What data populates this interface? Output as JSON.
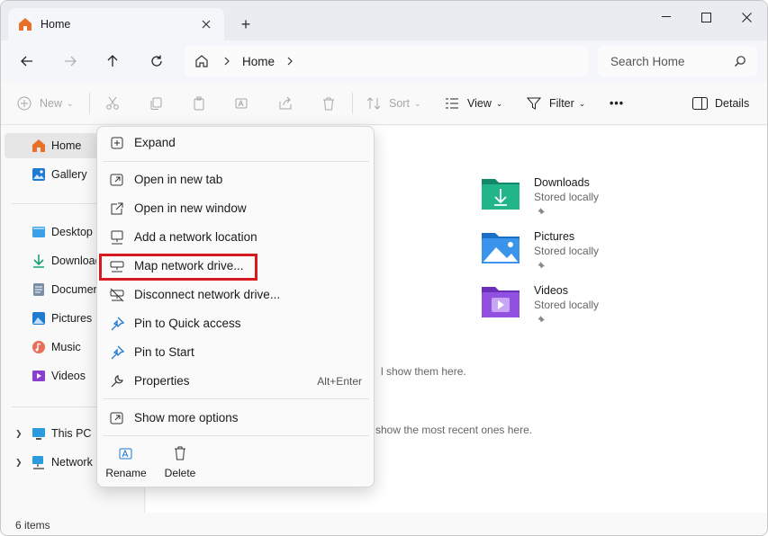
{
  "colors": {
    "accent": "#0067c0",
    "highlight": "#d71920",
    "folder_home": "#e8702a"
  },
  "tab": {
    "title": "Home",
    "close_icon": "close-icon",
    "new_tab_label": "+"
  },
  "nav": {
    "breadcrumb": "Home",
    "search_placeholder": "Search Home"
  },
  "toolbar": {
    "new_label": "New",
    "sort_label": "Sort",
    "view_label": "View",
    "filter_label": "Filter",
    "more_label": "•••",
    "details_label": "Details"
  },
  "sidebar": {
    "items": [
      {
        "label": "Home",
        "icon": "home-icon"
      },
      {
        "label": "Gallery",
        "icon": "gallery-icon"
      },
      {
        "label": "Desktop",
        "icon": "desktop-icon"
      },
      {
        "label": "Downloads",
        "icon": "download-icon"
      },
      {
        "label": "Documents",
        "icon": "documents-icon"
      },
      {
        "label": "Pictures",
        "icon": "pictures-icon"
      },
      {
        "label": "Music",
        "icon": "music-icon"
      },
      {
        "label": "Videos",
        "icon": "videos-icon"
      },
      {
        "label": "This PC",
        "icon": "pc-icon"
      },
      {
        "label": "Network",
        "icon": "network-icon"
      }
    ]
  },
  "quick_access": [
    {
      "name": "Downloads",
      "sub": "Stored locally"
    },
    {
      "name": "Pictures",
      "sub": "Stored locally"
    },
    {
      "name": "Videos",
      "sub": "Stored locally"
    }
  ],
  "hints": {
    "favorites": "l show them here.",
    "recent": "show the most recent ones here."
  },
  "status": {
    "items_count": "6 items"
  },
  "context_menu": {
    "items": [
      {
        "label": "Expand",
        "icon": "expand-icon"
      },
      {
        "label": "Open in new tab",
        "icon": "open-new-tab-icon"
      },
      {
        "label": "Open in new window",
        "icon": "open-new-window-icon"
      },
      {
        "label": "Add a network location",
        "icon": "network-location-icon"
      },
      {
        "label": "Map network drive...",
        "icon": "map-drive-icon"
      },
      {
        "label": "Disconnect network drive...",
        "icon": "disconnect-drive-icon"
      },
      {
        "label": "Pin to Quick access",
        "icon": "pin-icon"
      },
      {
        "label": "Pin to Start",
        "icon": "pin-start-icon"
      },
      {
        "label": "Properties",
        "icon": "wrench-icon",
        "shortcut": "Alt+Enter"
      },
      {
        "label": "Show more options",
        "icon": "more-options-icon"
      }
    ],
    "buttons": [
      {
        "label": "Rename",
        "icon": "rename-icon"
      },
      {
        "label": "Delete",
        "icon": "trash-icon"
      }
    ]
  }
}
